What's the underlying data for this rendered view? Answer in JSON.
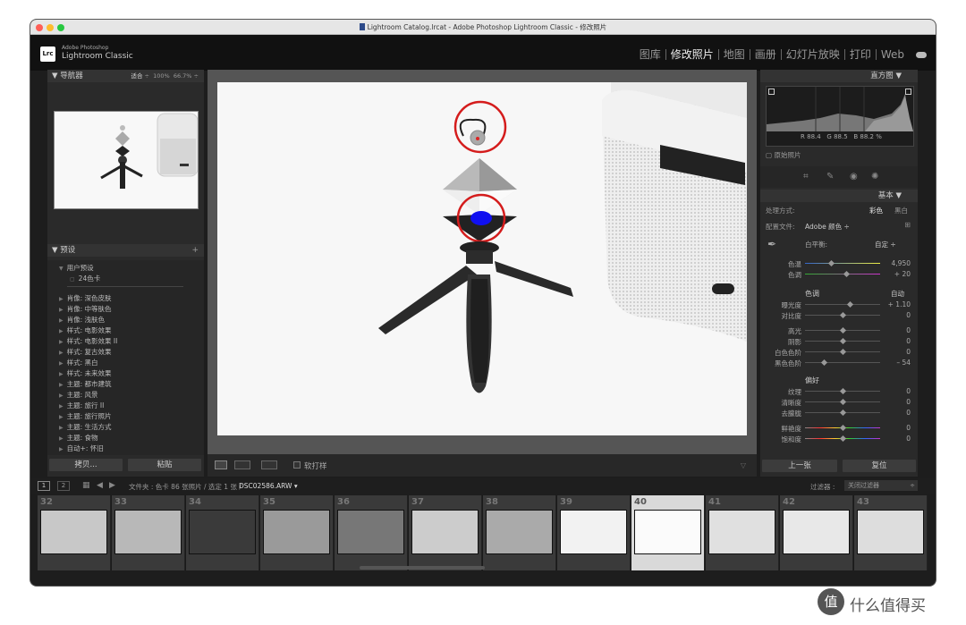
{
  "window": {
    "title": "Lightroom Catalog.lrcat - Adobe Photoshop Lightroom Classic - 修改照片"
  },
  "brand": {
    "logo": "Lrc",
    "line1": "Adobe Photoshop",
    "line2": "Lightroom Classic"
  },
  "modules": [
    {
      "label": "图库"
    },
    {
      "label": "修改照片"
    },
    {
      "label": "地图"
    },
    {
      "label": "画册"
    },
    {
      "label": "幻灯片放映"
    },
    {
      "label": "打印"
    },
    {
      "label": "Web"
    }
  ],
  "navigator": {
    "title": "导航器",
    "fit": "适合",
    "z100": "100%",
    "z667": "66.7%"
  },
  "presets": {
    "title": "预设",
    "group": "用户预设",
    "user_item": "24色卡",
    "items": [
      "肖像: 深色皮肤",
      "肖像: 中等肤色",
      "肖像: 浅肤色",
      "样式: 电影效果",
      "样式: 电影效果 II",
      "样式: 复古效果",
      "样式: 黑白",
      "样式: 未来效果",
      "主题: 都市建筑",
      "主题: 风景",
      "主题: 旅行 II",
      "主题: 旅行照片",
      "主题: 生活方式",
      "主题: 食物",
      "自动+: 怀旧"
    ]
  },
  "left_buttons": {
    "copy": "拷贝...",
    "paste": "粘贴"
  },
  "toolbar": {
    "softproof": "软打样"
  },
  "histogram": {
    "title": "直方图",
    "r_label": "R",
    "r": "88.4",
    "g_label": "G",
    "g": "88.5",
    "b_label": "B",
    "b": "88.2",
    "pct": "%",
    "original": "原始照片"
  },
  "basic": {
    "title": "基本",
    "treatment": "处理方式:",
    "color": "彩色",
    "bw": "黑白",
    "profile_label": "配置文件:",
    "profile": "Adobe 颜色",
    "wb_label": "白平衡:",
    "wb": "自定",
    "tone": "色调",
    "auto": "自动",
    "presence": "偏好",
    "sliders": [
      {
        "label": "色温",
        "value": "4,950",
        "pos": 0.35
      },
      {
        "label": "色调",
        "value": "+ 20",
        "pos": 0.55
      },
      {
        "label": "曝光度",
        "value": "+ 1.10",
        "pos": 0.6
      },
      {
        "label": "对比度",
        "value": "0",
        "pos": 0.5
      },
      {
        "label": "高光",
        "value": "0",
        "pos": 0.5
      },
      {
        "label": "阴影",
        "value": "0",
        "pos": 0.5
      },
      {
        "label": "白色色阶",
        "value": "0",
        "pos": 0.5
      },
      {
        "label": "黑色色阶",
        "value": "– 54",
        "pos": 0.25
      },
      {
        "label": "纹理",
        "value": "0",
        "pos": 0.5
      },
      {
        "label": "清晰度",
        "value": "0",
        "pos": 0.5
      },
      {
        "label": "去朦胧",
        "value": "0",
        "pos": 0.5
      },
      {
        "label": "鲜艳度",
        "value": "0",
        "pos": 0.5
      },
      {
        "label": "饱和度",
        "value": "0",
        "pos": 0.5
      }
    ]
  },
  "right_buttons": {
    "prev": "上一张",
    "reset": "复位"
  },
  "filmbar": {
    "page1": "1",
    "page2": "2",
    "info": "文件夹 : 色卡  86 张照片 / 选定 1 张 /",
    "filename": "DSC02586.ARW",
    "filter_label": "过滤器 :",
    "filter": "关闭过滤器"
  },
  "filmstrip": [
    {
      "n": "32"
    },
    {
      "n": "33"
    },
    {
      "n": "34"
    },
    {
      "n": "35"
    },
    {
      "n": "36"
    },
    {
      "n": "37"
    },
    {
      "n": "38"
    },
    {
      "n": "39"
    },
    {
      "n": "40"
    },
    {
      "n": "41"
    },
    {
      "n": "42"
    },
    {
      "n": "43"
    }
  ],
  "watermark": {
    "icon": "值",
    "text": "什么值得买"
  }
}
